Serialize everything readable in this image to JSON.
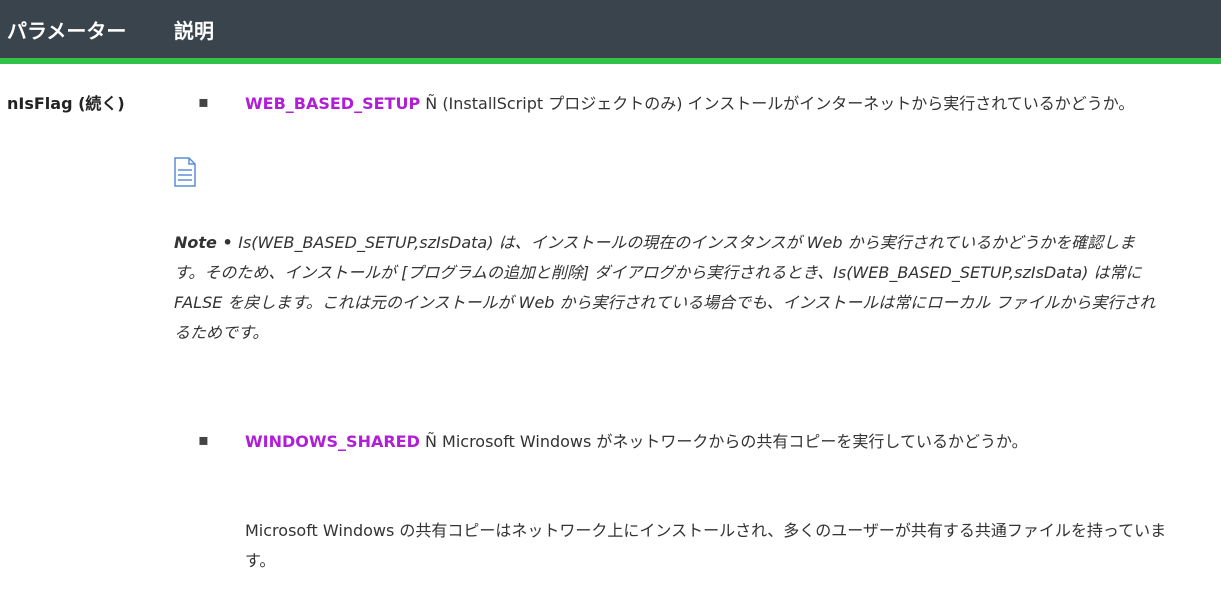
{
  "table": {
    "headers": [
      "パラメーター",
      "説明"
    ],
    "parameter": "nIsFlag (続く)"
  },
  "items": [
    {
      "link": "WEB_BASED_SETUP",
      "text": " Ñ (InstallScript  プロジェクトのみ) インストールがインターネットから実行されているかどうか。"
    },
    {
      "link": "WINDOWS_SHARED",
      "text": " Ñ Microsoft Windows がネットワークからの共有コピーを実行しているかどうか。"
    }
  ],
  "note": {
    "label": "Note • ",
    "text": "Is(WEB_BASED_SETUP,szIsData) は、インストールの現在のインスタンスが Web から実行されているかどうかを確認します。そのため、インストールが [プログラムの追加と削除] ダイアログから実行されるとき、Is(WEB_BASED_SETUP,szIsData) は常に FALSE を戻します。これは元のインストールが Web から実行されている場合でも、インストールは常にローカル ファイルから実行されるためです。",
    "icon": "note-document-icon"
  },
  "paragraph": "Microsoft Windows の共有コピーはネットワーク上にインストールされ、多くのユーザーが共有する共通ファイルを持っています。",
  "bullet_char": "▪",
  "colors": {
    "header_bg": "#3a444c",
    "header_accent": "#32c24a",
    "link": "#b01ed6",
    "icon": "#5a8fd8"
  }
}
